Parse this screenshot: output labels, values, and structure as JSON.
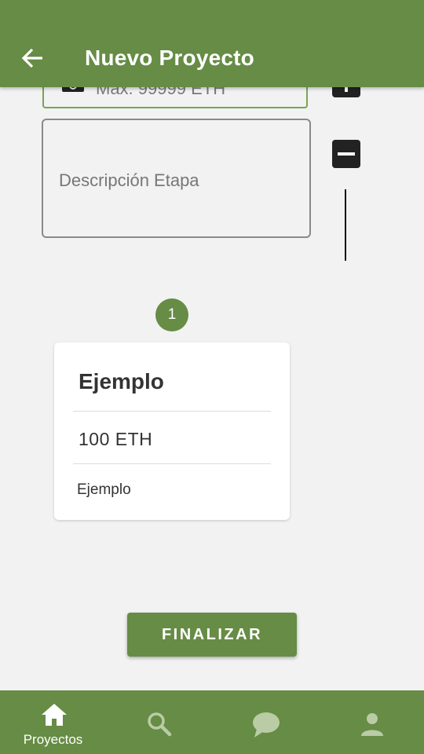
{
  "header": {
    "title": "Nuevo Proyecto",
    "back_icon": "arrow-left-icon"
  },
  "form": {
    "amount_placeholder": "Max. 99999 ETH",
    "amount_icon": "camera-icon",
    "description_placeholder": "Descripción Etapa",
    "add_icon": "plus-icon",
    "remove_icon": "minus-icon"
  },
  "stage": {
    "number": "1",
    "title": "Ejemplo",
    "amount": "100 ETH",
    "description": "Ejemplo"
  },
  "actions": {
    "finish_label": "FINALIZAR"
  },
  "bottom_nav": {
    "items": [
      {
        "label": "Proyectos",
        "icon": "home-icon",
        "active": true
      },
      {
        "label": "",
        "icon": "search-icon",
        "active": false
      },
      {
        "label": "",
        "icon": "chat-icon",
        "active": false
      },
      {
        "label": "",
        "icon": "person-icon",
        "active": false
      }
    ]
  },
  "colors": {
    "primary": "#668c45",
    "field_focus": "#79a454",
    "background": "#f2f2f2",
    "inactive_icon": "#b9cca6"
  }
}
